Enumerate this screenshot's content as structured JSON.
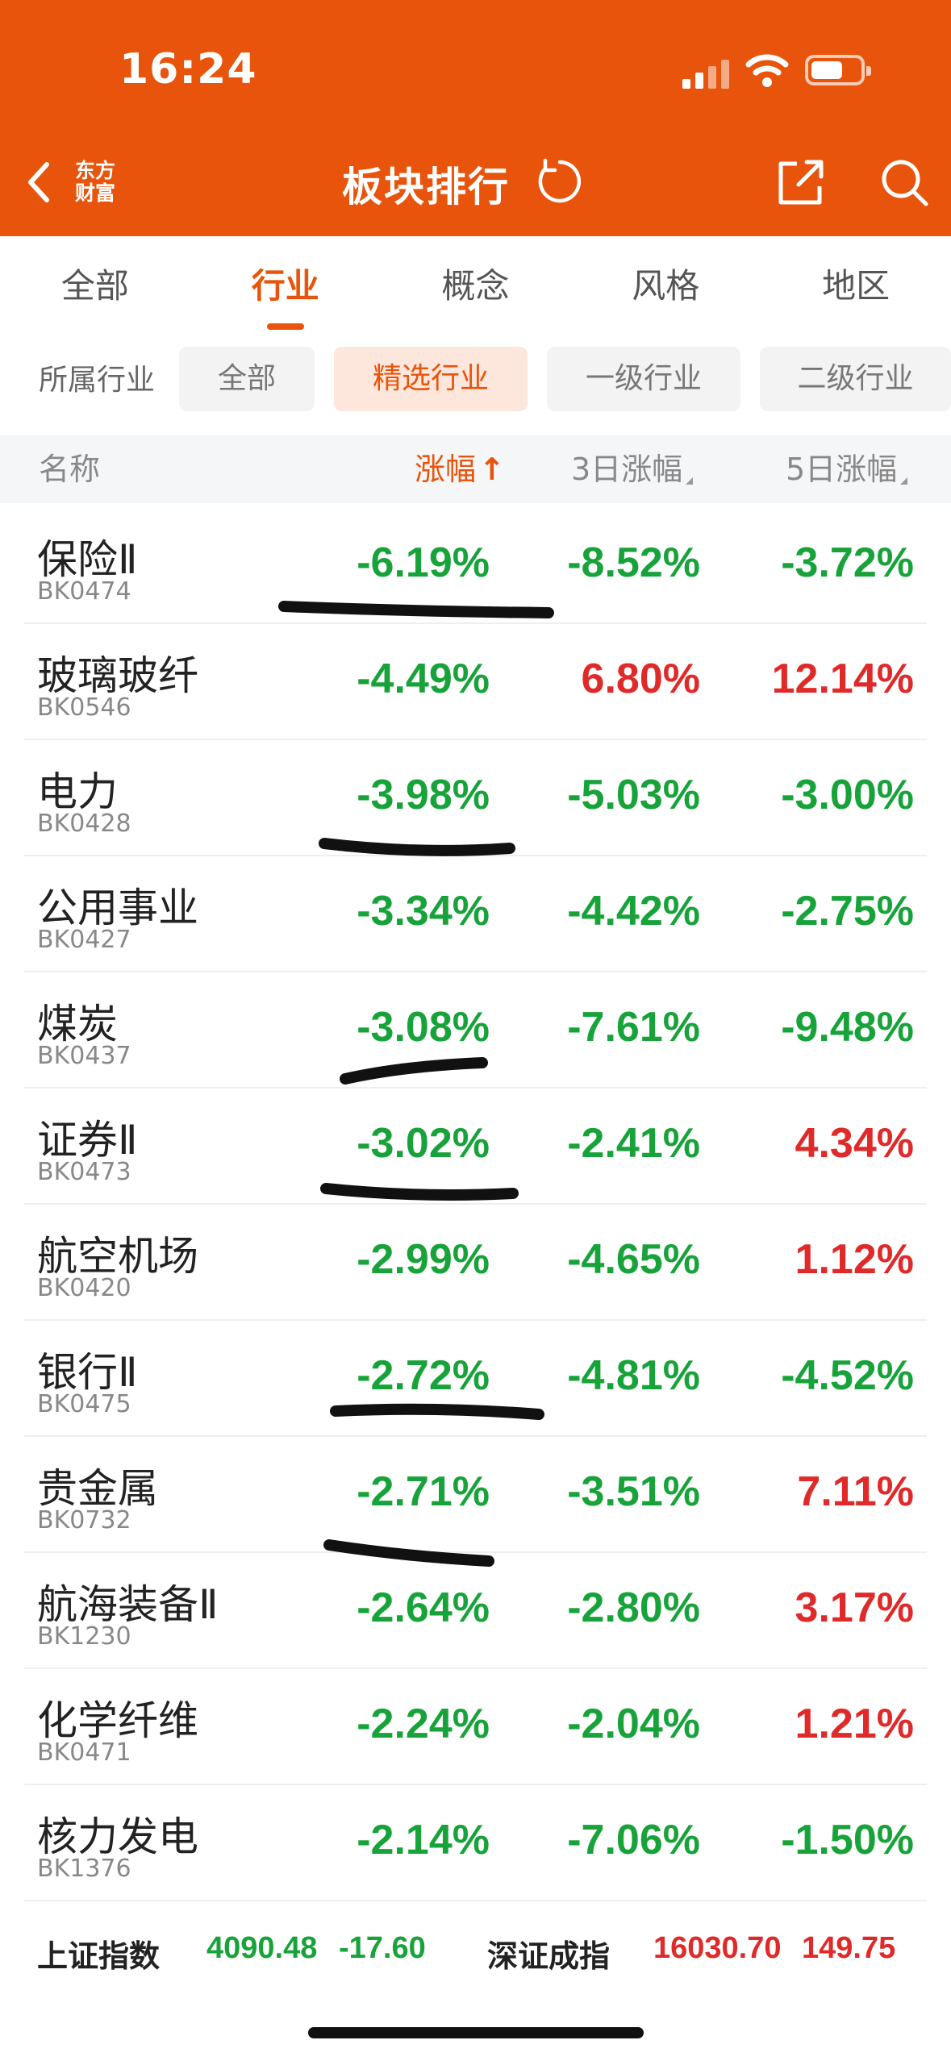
{
  "status_bar": {
    "time": "16:24"
  },
  "header": {
    "logo_text": "东方财富",
    "title": "板块排行",
    "bg_color": "#e8540b"
  },
  "tabs": [
    "全部",
    "行业",
    "概念",
    "风格",
    "地区"
  ],
  "active_tab": "行业",
  "filters": {
    "label": "所属行业",
    "chips": [
      "全部",
      "精选行业",
      "一级行业",
      "二级行业"
    ],
    "active_chip": "精选行业"
  },
  "columns": {
    "name": "名称",
    "change": "涨幅",
    "change_arrow": "↑",
    "change_3d": "3日涨幅",
    "change_5d": "5日涨幅"
  },
  "colors": {
    "up": "#e02a2a",
    "down": "#18a33a",
    "accent": "#e8540b"
  },
  "rows": [
    {
      "name": "保险Ⅱ",
      "code": "BK0474",
      "change": "-6.19%",
      "change_3d": "-8.52%",
      "change_5d": "-3.72%"
    },
    {
      "name": "玻璃玻纤",
      "code": "BK0546",
      "change": "-4.49%",
      "change_3d": "6.80%",
      "change_5d": "12.14%"
    },
    {
      "name": "电力",
      "code": "BK0428",
      "change": "-3.98%",
      "change_3d": "-5.03%",
      "change_5d": "-3.00%"
    },
    {
      "name": "公用事业",
      "code": "BK0427",
      "change": "-3.34%",
      "change_3d": "-4.42%",
      "change_5d": "-2.75%"
    },
    {
      "name": "煤炭",
      "code": "BK0437",
      "change": "-3.08%",
      "change_3d": "-7.61%",
      "change_5d": "-9.48%"
    },
    {
      "name": "证券Ⅱ",
      "code": "BK0473",
      "change": "-3.02%",
      "change_3d": "-2.41%",
      "change_5d": "4.34%"
    },
    {
      "name": "航空机场",
      "code": "BK0420",
      "change": "-2.99%",
      "change_3d": "-4.65%",
      "change_5d": "1.12%"
    },
    {
      "name": "银行Ⅱ",
      "code": "BK0475",
      "change": "-2.72%",
      "change_3d": "-4.81%",
      "change_5d": "-4.52%"
    },
    {
      "name": "贵金属",
      "code": "BK0732",
      "change": "-2.71%",
      "change_3d": "-3.51%",
      "change_5d": "7.11%"
    },
    {
      "name": "航海装备Ⅱ",
      "code": "BK1230",
      "change": "-2.64%",
      "change_3d": "-2.80%",
      "change_5d": "3.17%"
    },
    {
      "name": "化学纤维",
      "code": "BK0471",
      "change": "-2.24%",
      "change_3d": "-2.04%",
      "change_5d": "1.21%"
    },
    {
      "name": "核力发电",
      "code": "BK1376",
      "change": "-2.14%",
      "change_3d": "-7.06%",
      "change_5d": "-1.50%"
    }
  ],
  "footer": {
    "sh_name": "上证指数",
    "sh_value": "4090.48",
    "sh_change": "-17.60",
    "sz_name": "深证成指",
    "sz_value": "16030.70",
    "sz_change": "149.75"
  }
}
